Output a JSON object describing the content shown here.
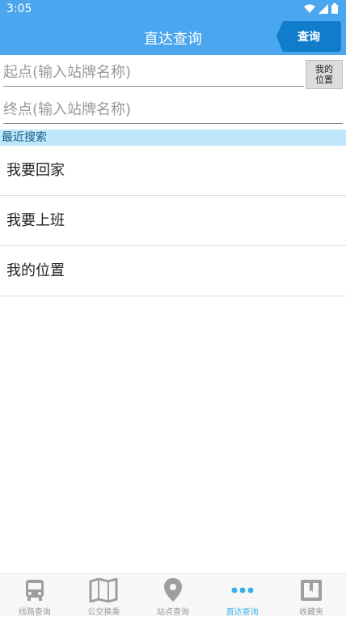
{
  "status": {
    "time": "3:05"
  },
  "header": {
    "title": "直达查询",
    "query_label": "查询"
  },
  "form": {
    "start_placeholder": "起点(输入站牌名称)",
    "end_placeholder": "终点(输入站牌名称)",
    "my_location_label_line1": "我的",
    "my_location_label_line2": "位置"
  },
  "recent": {
    "title": "最近搜索",
    "items": [
      "我要回家",
      "我要上班",
      "我的位置"
    ]
  },
  "nav": {
    "items": [
      {
        "label": "线路查询",
        "icon": "bus-icon"
      },
      {
        "label": "公交换乘",
        "icon": "map-icon"
      },
      {
        "label": "站点查询",
        "icon": "location-pin-icon"
      },
      {
        "label": "直达查询",
        "icon": "more-dots-icon",
        "active": true
      },
      {
        "label": "收藏夹",
        "icon": "bookmark-icon"
      }
    ]
  },
  "colors": {
    "primary": "#4aa6ee",
    "query_button": "#0f7ccc",
    "active_tab": "#3ab2e8",
    "section_bg": "#bfe7fb"
  }
}
